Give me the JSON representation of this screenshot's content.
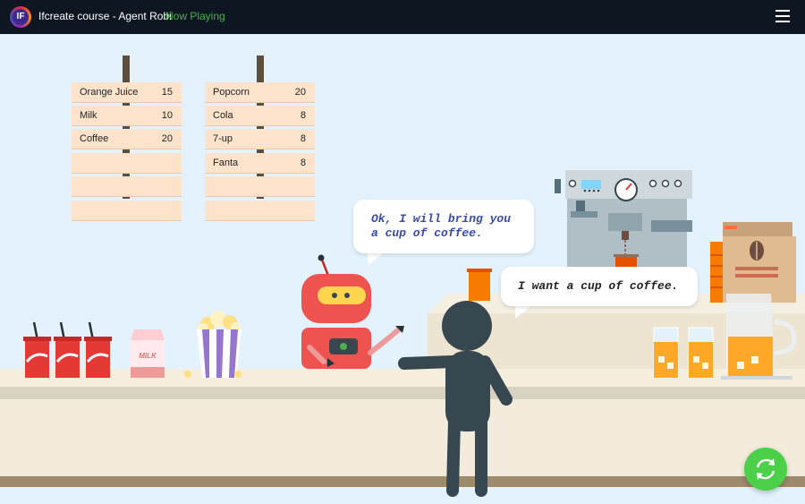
{
  "header": {
    "logo_text": "IF",
    "title": "Ifcreate course - Agent Robi",
    "status": "Now Playing"
  },
  "menu_board_left": [
    {
      "name": "Orange Juice",
      "price": "15"
    },
    {
      "name": "Milk",
      "price": "10"
    },
    {
      "name": "Coffee",
      "price": "20"
    },
    {
      "name": "",
      "price": ""
    },
    {
      "name": "",
      "price": ""
    },
    {
      "name": "",
      "price": ""
    }
  ],
  "menu_board_right": [
    {
      "name": "Popcorn",
      "price": "20"
    },
    {
      "name": "Cola",
      "price": "8"
    },
    {
      "name": "7-up",
      "price": "8"
    },
    {
      "name": "Fanta",
      "price": "8"
    },
    {
      "name": "",
      "price": ""
    },
    {
      "name": "",
      "price": ""
    }
  ],
  "robot_speech": {
    "line1": "Ok, I will bring you",
    "line2": "a cup of coffee."
  },
  "customer_speech": "I want a cup of coffee.",
  "milk_carton_label": "MILK",
  "colors": {
    "topbar": "#0e1621",
    "status": "#4caf50",
    "sky": "#e3f2fd",
    "robot": "#ef5350",
    "person": "#37474f",
    "fab": "#4cd04a"
  },
  "icons": [
    "hamburger-menu-icon",
    "refresh-icon"
  ]
}
